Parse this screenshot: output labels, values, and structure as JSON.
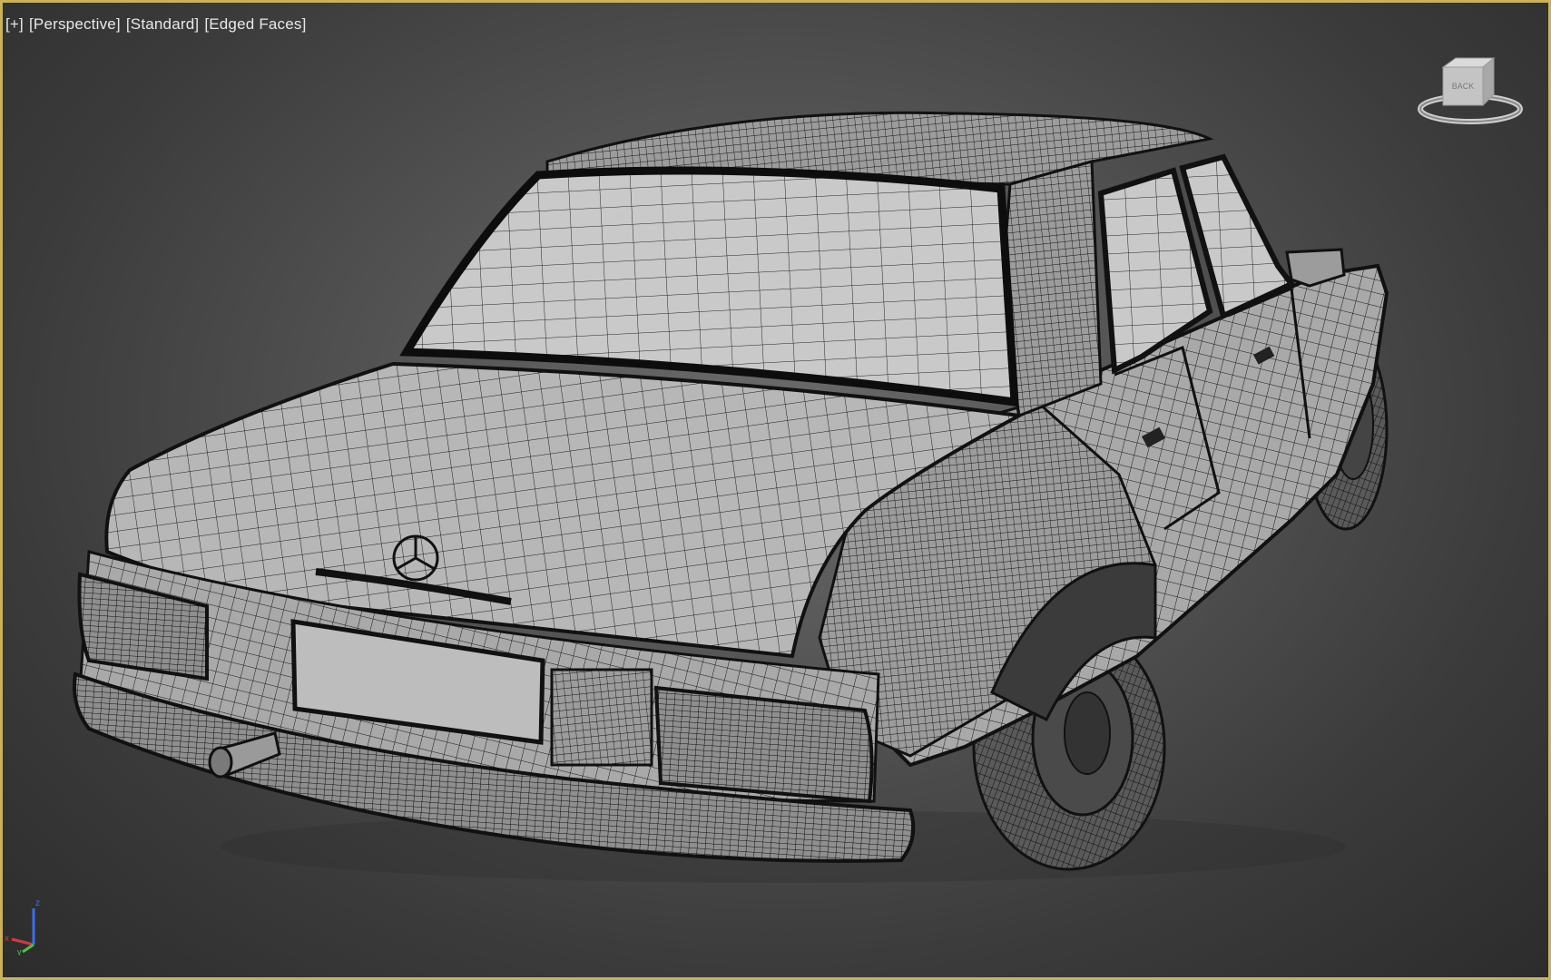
{
  "viewport": {
    "label_plus": "[+]",
    "label_view": "[Perspective]",
    "label_shading": "[Standard]",
    "label_mode": "[Edged Faces]",
    "border_color": "#c9b35a",
    "background_colors": [
      "#6a6a6a",
      "#2c2c2c"
    ]
  },
  "viewcube": {
    "face_label": "BACK",
    "icon": "viewcube-icon"
  },
  "axis_tripod": {
    "x_label": "x",
    "y_label": "y",
    "z_label": "z",
    "x_color": "#d23a3a",
    "y_color": "#4cc04c",
    "z_color": "#3a6ee8"
  },
  "model": {
    "icon": "car-wireframe-icon",
    "emblem_icon": "three-pointed-star-emblem-icon"
  }
}
